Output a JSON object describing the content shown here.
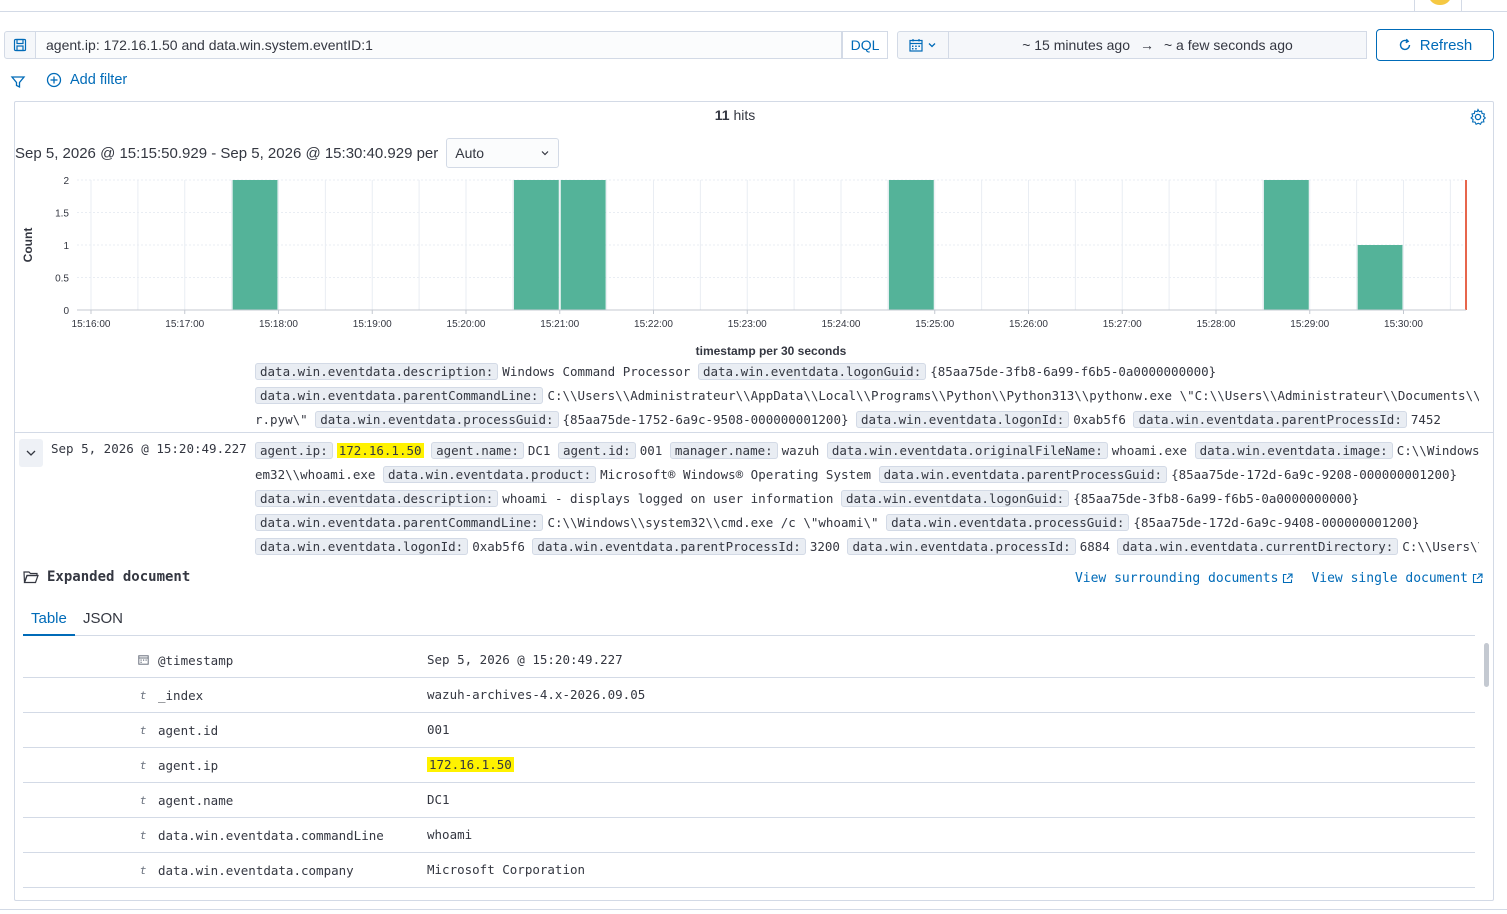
{
  "query": {
    "text": "agent.ip: 172.16.1.50 and data.win.system.eventID:1",
    "language": "DQL"
  },
  "time_range": {
    "start": "~ 15 minutes ago",
    "arrow": "→",
    "end": "~ a few seconds ago"
  },
  "refresh_label": "Refresh",
  "add_filter_label": "Add filter",
  "hits": {
    "count": "11",
    "label": "hits"
  },
  "interval": {
    "text": "Sep 5, 2026 @ 15:15:50.929 - Sep 5, 2026 @ 15:30:40.929 per",
    "selected": "Auto"
  },
  "chart_data": {
    "type": "bar",
    "xlabel": "timestamp per 30 seconds",
    "ylabel": "Count",
    "ylim": [
      0,
      2
    ],
    "yticks": [
      "0",
      "0.5",
      "1",
      "1.5",
      "2"
    ],
    "xticks": [
      "15:16:00",
      "15:17:00",
      "15:18:00",
      "15:19:00",
      "15:20:00",
      "15:21:00",
      "15:22:00",
      "15:23:00",
      "15:24:00",
      "15:25:00",
      "15:26:00",
      "15:27:00",
      "15:28:00",
      "15:29:00",
      "15:30:00"
    ],
    "bars": [
      {
        "x": "15:17:30",
        "y": 2
      },
      {
        "x": "15:20:30",
        "y": 2
      },
      {
        "x": "15:21:00",
        "y": 2
      },
      {
        "x": "15:24:30",
        "y": 2
      },
      {
        "x": "15:28:30",
        "y": 2
      },
      {
        "x": "15:29:30",
        "y": 1
      }
    ],
    "bar_color": "#54b399",
    "now_marker_color": "#e7664c",
    "grid": true
  },
  "previous_doc": {
    "lines": [
      [
        {
          "k": "data.win.eventdata.description:",
          "v": "Windows Command Processor"
        },
        {
          "k": "data.win.eventdata.logonGuid:",
          "v": "{85aa75de-3fb8-6a99-f6b5-0a0000000000}"
        }
      ],
      [
        {
          "k": "data.win.eventdata.parentCommandLine:",
          "v": "C:\\\\Users\\\\Administrateur\\\\AppData\\\\Local\\\\Programs\\\\Python\\\\Python313\\\\pythonw.exe \\\"C:\\\\Users\\\\Administrateur\\\\Documents\\\\update"
        }
      ],
      [
        {
          "k": "",
          "v": "r.pyw\\\""
        },
        {
          "k": "data.win.eventdata.processGuid:",
          "v": "{85aa75de-1752-6a9c-9508-000000001200}"
        },
        {
          "k": "data.win.eventdata.logonId:",
          "v": "0xab5f6"
        },
        {
          "k": "data.win.eventdata.parentProcessId:",
          "v": "7452"
        }
      ]
    ]
  },
  "doc": {
    "timestamp": "Sep 5, 2026 @ 15:20:49.227",
    "lines": [
      [
        {
          "k": "agent.ip:",
          "v": "172.16.1.50",
          "hl": true
        },
        {
          "k": "agent.name:",
          "v": "DC1"
        },
        {
          "k": "agent.id:",
          "v": "001"
        },
        {
          "k": "manager.name:",
          "v": "wazuh"
        },
        {
          "k": "data.win.eventdata.originalFileName:",
          "v": "whoami.exe"
        },
        {
          "k": "data.win.eventdata.image:",
          "v": "C:\\\\Windows\\\\Syst"
        }
      ],
      [
        {
          "k": "",
          "v": "em32\\\\whoami.exe"
        },
        {
          "k": "data.win.eventdata.product:",
          "v": "Microsoft® Windows® Operating System"
        },
        {
          "k": "data.win.eventdata.parentProcessGuid:",
          "v": "{85aa75de-172d-6a9c-9208-000000001200}"
        }
      ],
      [
        {
          "k": "data.win.eventdata.description:",
          "v": "whoami - displays logged on user information"
        },
        {
          "k": "data.win.eventdata.logonGuid:",
          "v": "{85aa75de-3fb8-6a99-f6b5-0a0000000000}"
        }
      ],
      [
        {
          "k": "data.win.eventdata.parentCommandLine:",
          "v": "C:\\\\Windows\\\\system32\\\\cmd.exe /c \\\"whoami\\\""
        },
        {
          "k": "data.win.eventdata.processGuid:",
          "v": "{85aa75de-172d-6a9c-9408-000000001200}"
        }
      ],
      [
        {
          "k": "data.win.eventdata.logonId:",
          "v": "0xab5f6"
        },
        {
          "k": "data.win.eventdata.parentProcessId:",
          "v": "3200"
        },
        {
          "k": "data.win.eventdata.processId:",
          "v": "6884"
        },
        {
          "k": "data.win.eventdata.currentDirectory:",
          "v": "C:\\\\Users\\\\Admin"
        }
      ]
    ]
  },
  "expanded": {
    "title": "Expanded document",
    "link_surrounding": "View surrounding documents",
    "link_single": "View single document",
    "tabs": [
      "Table",
      "JSON"
    ],
    "rows": [
      {
        "icon": "calendar",
        "name": "@timestamp",
        "value": "Sep 5, 2026 @ 15:20:49.227"
      },
      {
        "icon": "t",
        "name": "_index",
        "value": "wazuh-archives-4.x-2026.09.05"
      },
      {
        "icon": "t",
        "name": "agent.id",
        "value": "001"
      },
      {
        "icon": "t",
        "name": "agent.ip",
        "value": "172.16.1.50",
        "hl": true
      },
      {
        "icon": "t",
        "name": "agent.name",
        "value": "DC1"
      },
      {
        "icon": "t",
        "name": "data.win.eventdata.commandLine",
        "value": "whoami"
      },
      {
        "icon": "t",
        "name": "data.win.eventdata.company",
        "value": "Microsoft Corporation"
      }
    ]
  }
}
